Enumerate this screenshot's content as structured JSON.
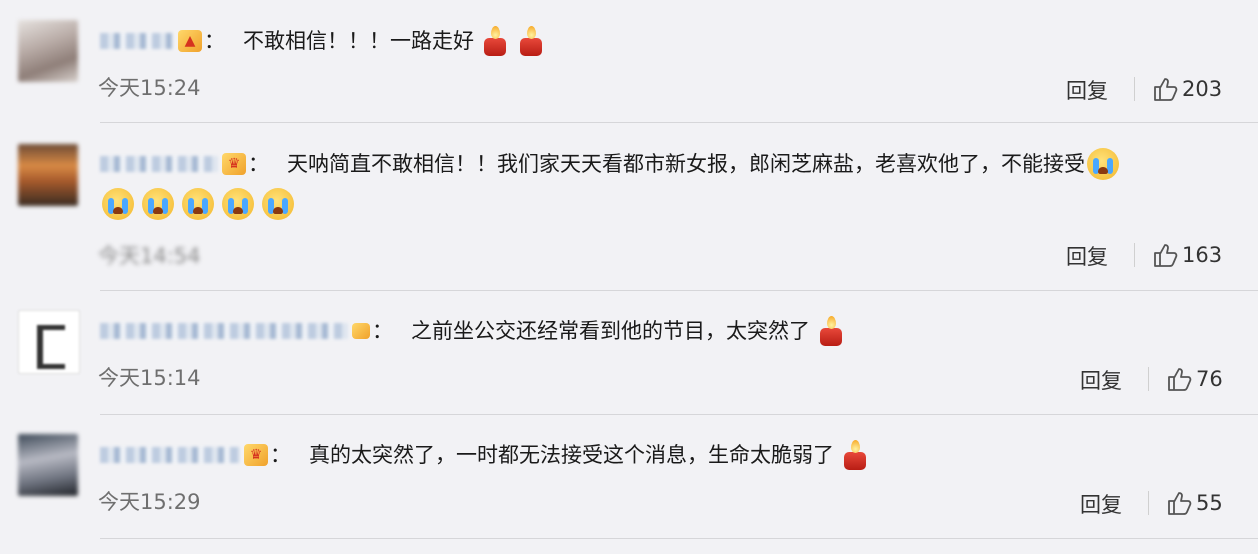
{
  "comments": [
    {
      "text": "不敢相信！！！一路走好",
      "time": "今天15:24",
      "reply_label": "回复",
      "likes": "203",
      "trailing_emoji": [
        "candle-icon",
        "candle-icon"
      ]
    },
    {
      "text": "天呐简直不敢相信！！我们家天天看都市新女报，郎闲芝麻盐，老喜欢他了，不能接受",
      "time": "今天14:54",
      "reply_label": "回复",
      "likes": "163",
      "trailing_emoji": [
        "crying-face-icon",
        "crying-face-icon",
        "crying-face-icon",
        "crying-face-icon",
        "crying-face-icon",
        "crying-face-icon"
      ]
    },
    {
      "text": "之前坐公交还经常看到他的节目，太突然了",
      "time": "今天15:14",
      "reply_label": "回复",
      "likes": "76",
      "trailing_emoji": [
        "candle-icon"
      ]
    },
    {
      "text": "真的太突然了，一时都无法接受这个消息，生命太脆弱了",
      "time": "今天15:29",
      "reply_label": "回复",
      "likes": "55",
      "trailing_emoji": [
        "candle-icon"
      ]
    }
  ],
  "colon": "：",
  "colors": {
    "background": "#f2f2f5",
    "time": "#6f6f6f",
    "divider": "#d6d6d9"
  }
}
